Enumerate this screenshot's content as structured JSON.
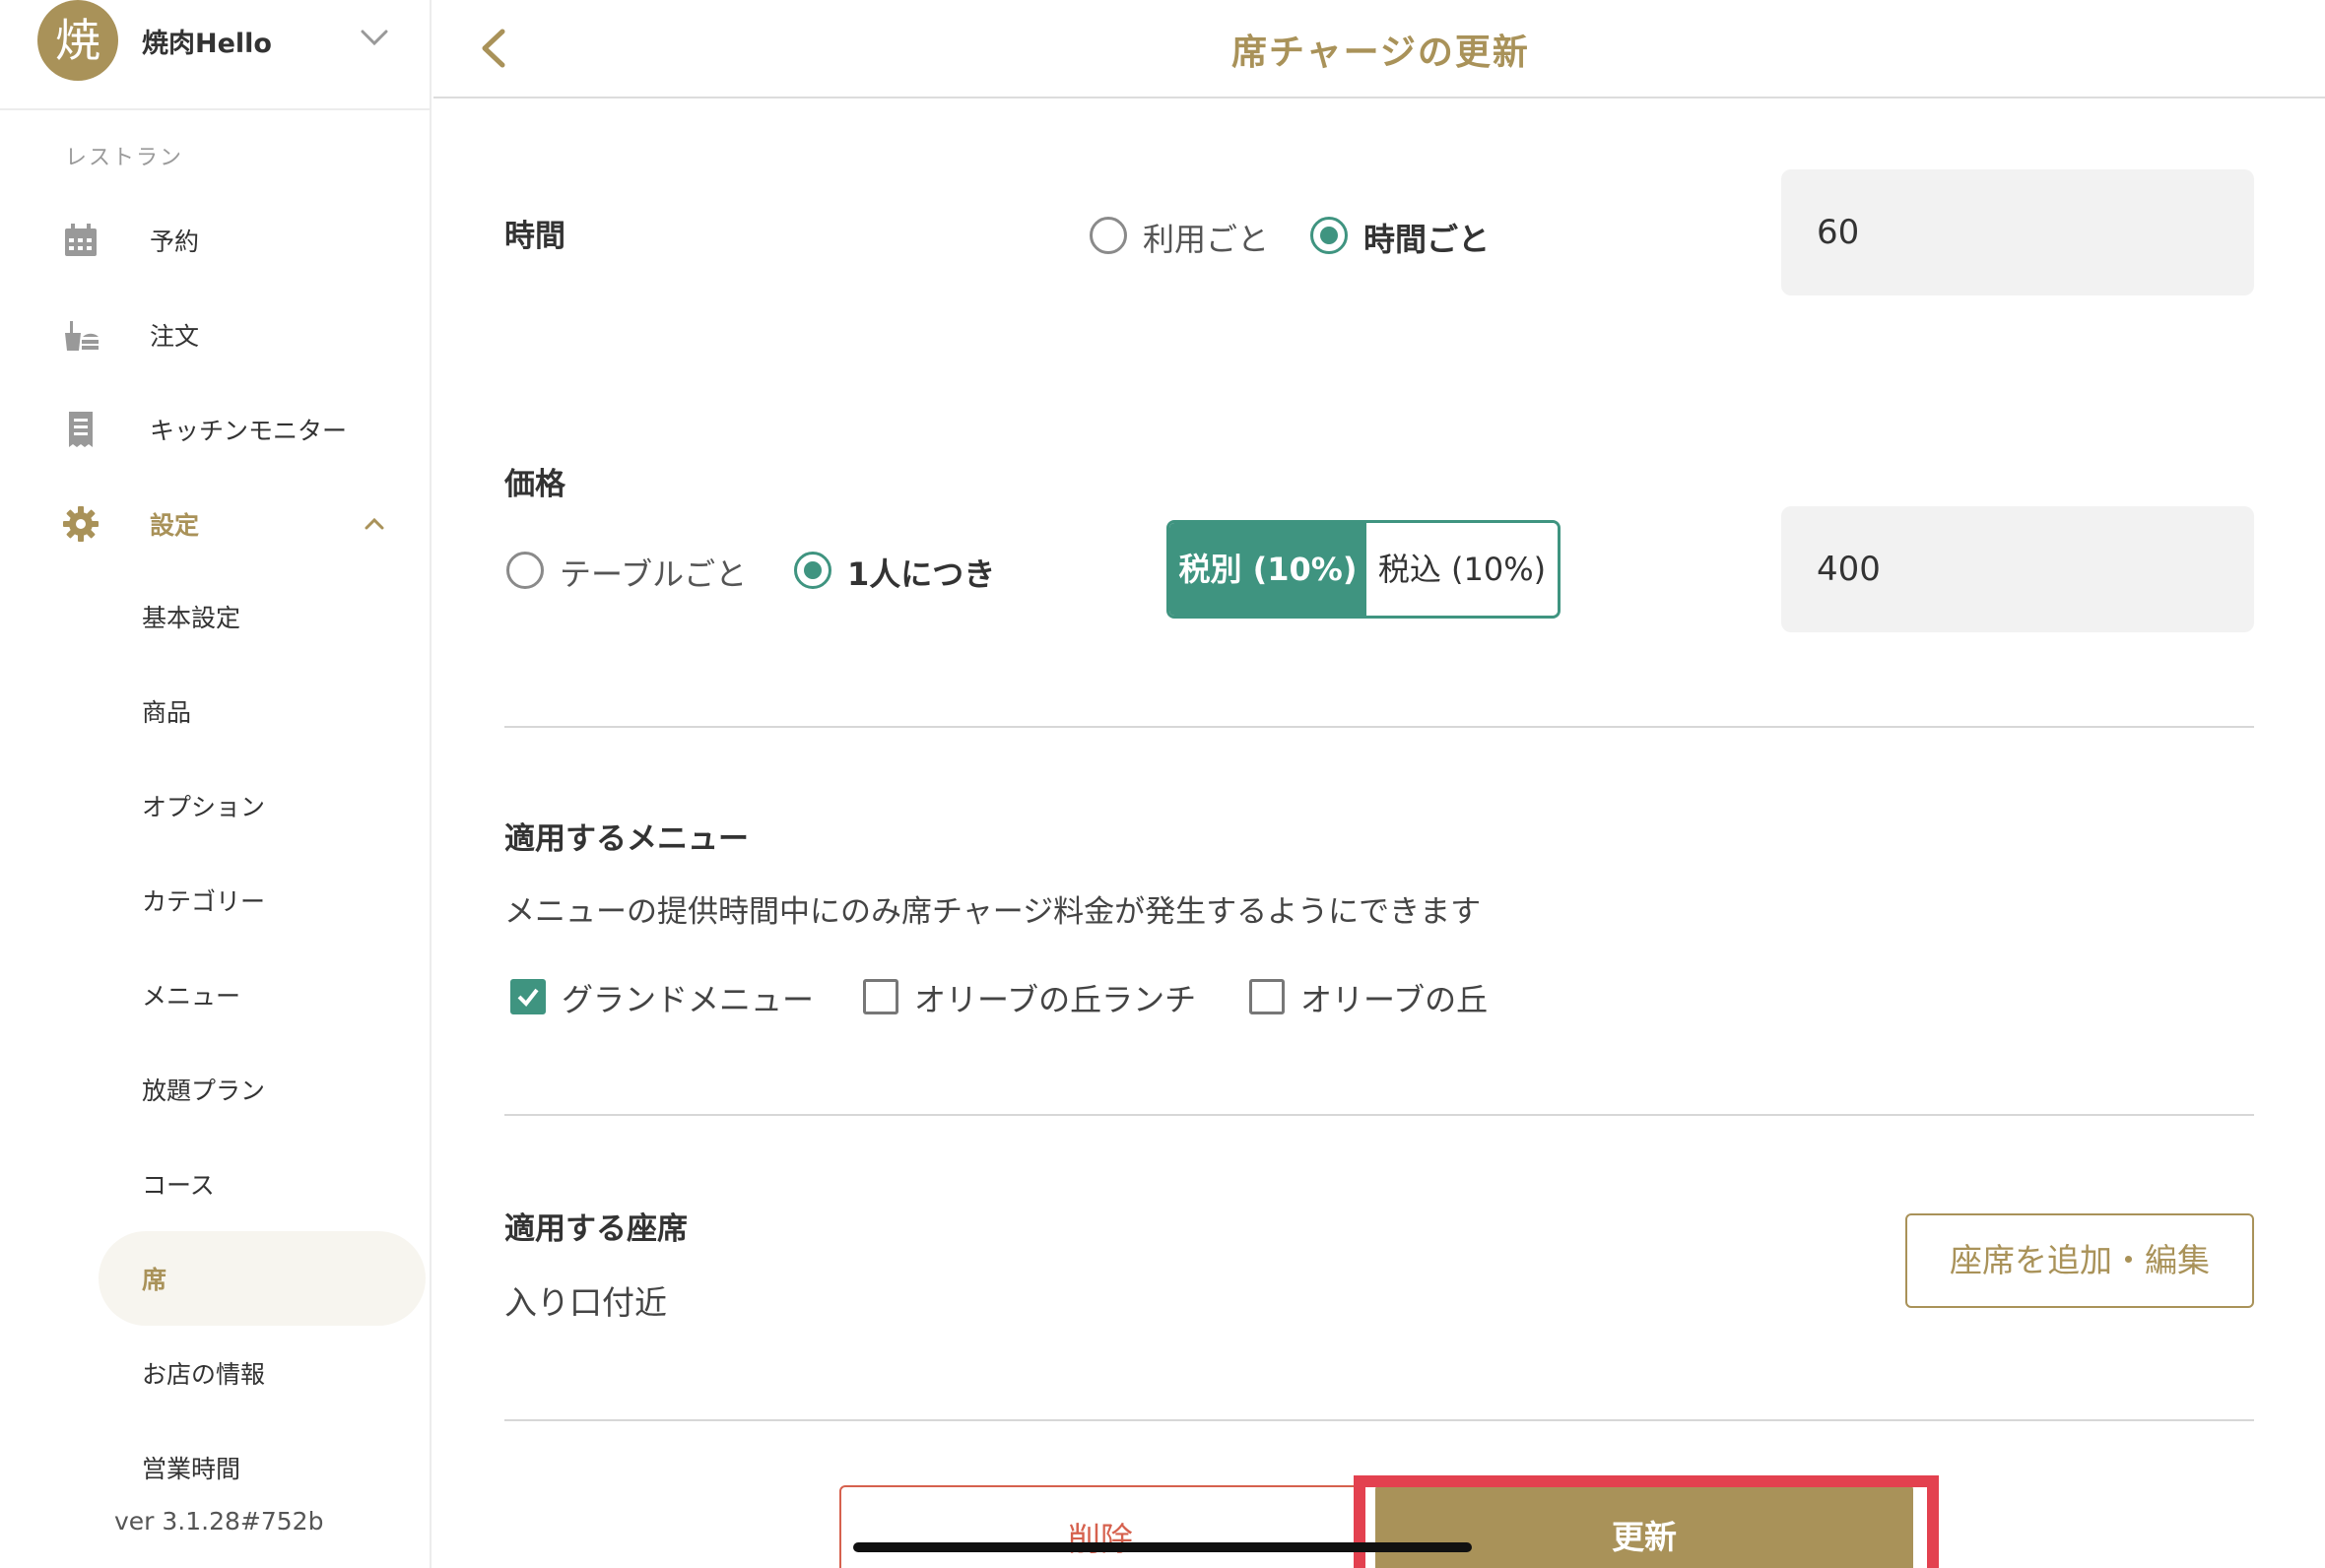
{
  "brand": {
    "avatar_char": "焼",
    "name": "焼肉Hello"
  },
  "sidebar": {
    "section_label": "レストラン",
    "items": [
      {
        "label": "予約",
        "icon": "calendar-icon"
      },
      {
        "label": "注文",
        "icon": "order-icon"
      },
      {
        "label": "キッチンモニター",
        "icon": "receipt-icon"
      },
      {
        "label": "設定",
        "icon": "gear-icon"
      }
    ],
    "sub_items": [
      {
        "label": "基本設定"
      },
      {
        "label": "商品"
      },
      {
        "label": "オプション"
      },
      {
        "label": "カテゴリー"
      },
      {
        "label": "メニュー"
      },
      {
        "label": "放題プラン"
      },
      {
        "label": "コース"
      },
      {
        "label": "席"
      },
      {
        "label": "お店の情報"
      },
      {
        "label": "営業時間"
      }
    ],
    "version": "ver 3.1.28#752b"
  },
  "header": {
    "title": "席チャージの更新"
  },
  "time": {
    "label": "時間",
    "options": [
      "利用ごと",
      "時間ごと"
    ],
    "selected": "時間ごと",
    "value": "60"
  },
  "price": {
    "label": "価格",
    "options": [
      "テーブルごと",
      "1人につき"
    ],
    "selected": "1人につき",
    "tax_options": [
      "税別 (10%)",
      "税込 (10%)"
    ],
    "tax_selected": "税別 (10%)",
    "value": "400"
  },
  "menus": {
    "label": "適用するメニュー",
    "description": "メニューの提供時間中にのみ席チャージ料金が発生するようにできます",
    "items": [
      {
        "label": "グランドメニュー",
        "checked": true
      },
      {
        "label": "オリーブの丘ランチ",
        "checked": false
      },
      {
        "label": "オリーブの丘",
        "checked": false
      }
    ]
  },
  "seats": {
    "label": "適用する座席",
    "value": "入り口付近",
    "edit_button": "座席を追加・編集"
  },
  "actions": {
    "delete": "削除",
    "update": "更新"
  },
  "colors": {
    "accent": "#a99259",
    "teal": "#3f9480",
    "danger": "#d6614e",
    "highlight": "#e3414f"
  }
}
